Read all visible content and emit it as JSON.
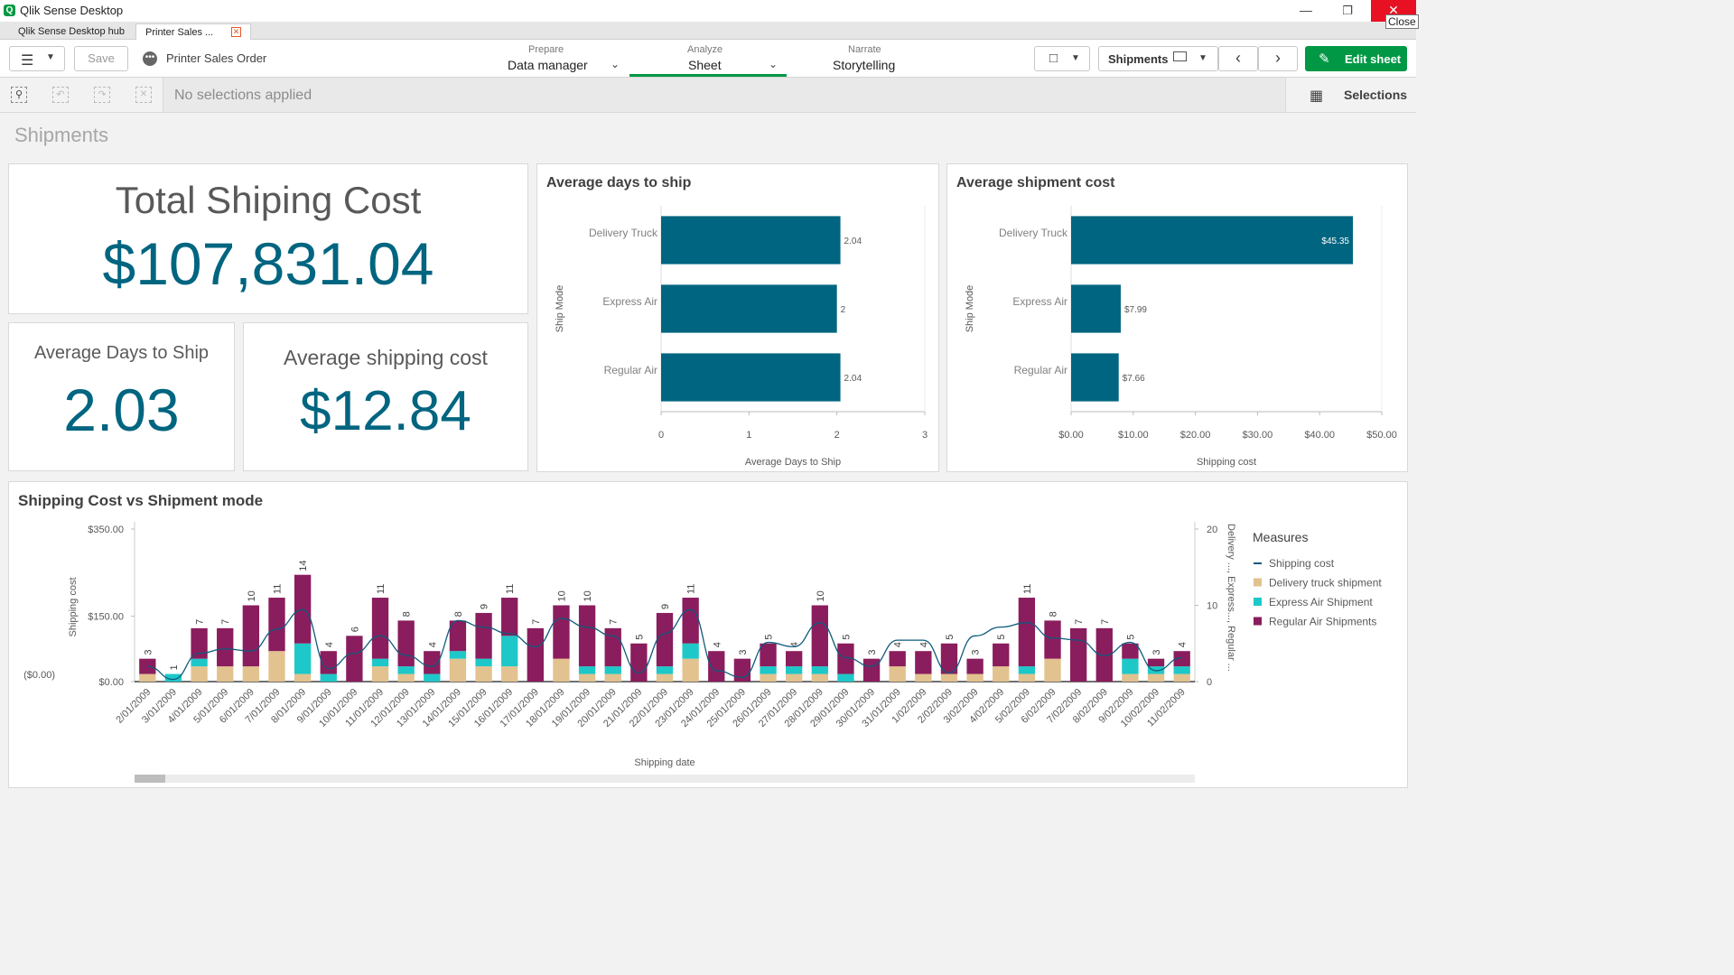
{
  "window": {
    "title": "Qlik Sense Desktop",
    "close_tooltip": "Close"
  },
  "tabs": [
    {
      "label": "Qlik Sense Desktop hub"
    },
    {
      "label": "Printer Sales ..."
    }
  ],
  "toolbar": {
    "save_label": "Save",
    "app_name": "Printer Sales Order",
    "nav": [
      {
        "small": "Prepare",
        "label": "Data manager"
      },
      {
        "small": "Analyze",
        "label": "Sheet"
      },
      {
        "small": "Narrate",
        "label": "Storytelling"
      }
    ],
    "sheet_name": "Shipments",
    "edit_label": "Edit sheet"
  },
  "selections": {
    "status": "No selections applied",
    "button_label": "Selections"
  },
  "sheet": {
    "title": "Shipments"
  },
  "kpis": {
    "total": {
      "title": "Total Shiping Cost",
      "value": "$107,831.04"
    },
    "avg_days": {
      "title": "Average Days to Ship",
      "value": "2.03"
    },
    "avg_cost": {
      "title": "Average shipping cost",
      "value": "$12.84"
    }
  },
  "colors": {
    "primary": "#006580",
    "delivery": "#e2c28f",
    "express": "#1ec8c8",
    "regular": "#8a1d5d",
    "line": "#0f5b7d",
    "edit_green": "#009845"
  },
  "chart_data": [
    {
      "type": "bar",
      "orientation": "horizontal",
      "title": "Average days to ship",
      "ylabel": "Ship Mode",
      "xlabel": "Average Days to Ship",
      "categories": [
        "Delivery Truck",
        "Express Air",
        "Regular Air"
      ],
      "values": [
        2.04,
        2,
        2.04
      ],
      "value_labels": [
        "2.04",
        "2",
        "2.04"
      ],
      "xlim": [
        0,
        3
      ],
      "xticks": [
        "0",
        "1",
        "2",
        "3"
      ]
    },
    {
      "type": "bar",
      "orientation": "horizontal",
      "title": "Average shipment cost",
      "ylabel": "Ship Mode",
      "xlabel": "Shipping cost",
      "categories": [
        "Delivery Truck",
        "Express Air",
        "Regular Air"
      ],
      "values": [
        45.35,
        7.99,
        7.66
      ],
      "value_labels": [
        "$45.35",
        "$7.99",
        "$7.66"
      ],
      "xlim": [
        0,
        50
      ],
      "xticks": [
        "$0.00",
        "$10.00",
        "$20.00",
        "$30.00",
        "$40.00",
        "$50.00"
      ]
    },
    {
      "type": "bar",
      "stacked": true,
      "title": "Shipping Cost vs Shipment mode",
      "xlabel": "Shipping date",
      "ylabel": "Shipping cost",
      "ylabel_right": "Delivery ..., Express..., Regular ...",
      "ylim": [
        0,
        350
      ],
      "yticks": [
        "$350.00",
        "$150.00",
        "$0.00"
      ],
      "extra_ytick": "($0.00)",
      "ylim_right": [
        0,
        20
      ],
      "yticks_right": [
        "20",
        "10",
        "0"
      ],
      "legend_title": "Measures",
      "legend_position": "right",
      "categories": [
        "2/01/2009",
        "3/01/2009",
        "4/01/2009",
        "5/01/2009",
        "6/01/2009",
        "7/01/2009",
        "8/01/2009",
        "9/01/2009",
        "10/01/2009",
        "11/01/2009",
        "12/01/2009",
        "13/01/2009",
        "14/01/2009",
        "15/01/2009",
        "16/01/2009",
        "17/01/2009",
        "18/01/2009",
        "19/01/2009",
        "20/01/2009",
        "21/01/2009",
        "22/01/2009",
        "23/01/2009",
        "24/01/2009",
        "25/01/2009",
        "26/01/2009",
        "27/01/2009",
        "28/01/2009",
        "29/01/2009",
        "30/01/2009",
        "31/01/2009",
        "1/02/2009",
        "2/02/2009",
        "3/02/2009",
        "4/02/2009",
        "5/02/2009",
        "6/02/2009",
        "7/02/2009",
        "8/02/2009",
        "9/02/2009",
        "10/02/2009",
        "11/02/2009"
      ],
      "totals": [
        3,
        1,
        7,
        7,
        10,
        11,
        14,
        4,
        6,
        11,
        8,
        4,
        8,
        9,
        11,
        7,
        10,
        10,
        7,
        5,
        9,
        11,
        4,
        3,
        5,
        4,
        10,
        5,
        3,
        4,
        4,
        5,
        3,
        5,
        11,
        8,
        7,
        7,
        5,
        3,
        4
      ],
      "series": [
        {
          "name": "Delivery truck shipment",
          "values": [
            1,
            0,
            2,
            2,
            2,
            4,
            1,
            0,
            0,
            2,
            1,
            0,
            3,
            2,
            2,
            0,
            3,
            1,
            1,
            0,
            1,
            3,
            0,
            0,
            1,
            1,
            1,
            0,
            0,
            2,
            1,
            1,
            1,
            2,
            1,
            3,
            0,
            0,
            1,
            1,
            1
          ]
        },
        {
          "name": "Express Air Shipment",
          "values": [
            0,
            1,
            1,
            0,
            0,
            0,
            4,
            1,
            0,
            1,
            1,
            1,
            1,
            1,
            4,
            0,
            0,
            1,
            1,
            0,
            1,
            2,
            0,
            0,
            1,
            1,
            1,
            1,
            0,
            0,
            0,
            0,
            0,
            0,
            1,
            0,
            0,
            0,
            2,
            1,
            1
          ]
        },
        {
          "name": "Regular Air Shipments",
          "values": [
            2,
            0,
            4,
            5,
            8,
            7,
            9,
            3,
            6,
            8,
            6,
            3,
            4,
            6,
            5,
            7,
            7,
            8,
            5,
            5,
            7,
            6,
            4,
            3,
            3,
            2,
            8,
            4,
            3,
            2,
            3,
            4,
            2,
            3,
            9,
            5,
            7,
            7,
            2,
            1,
            2
          ]
        },
        {
          "name": "Shipping cost",
          "values": [
            35,
            5,
            65,
            75,
            70,
            120,
            165,
            30,
            65,
            105,
            60,
            35,
            140,
            125,
            110,
            80,
            145,
            125,
            105,
            20,
            110,
            165,
            25,
            10,
            90,
            80,
            135,
            55,
            35,
            95,
            95,
            20,
            105,
            125,
            135,
            100,
            95,
            60,
            90,
            25,
            55
          ]
        }
      ]
    }
  ]
}
